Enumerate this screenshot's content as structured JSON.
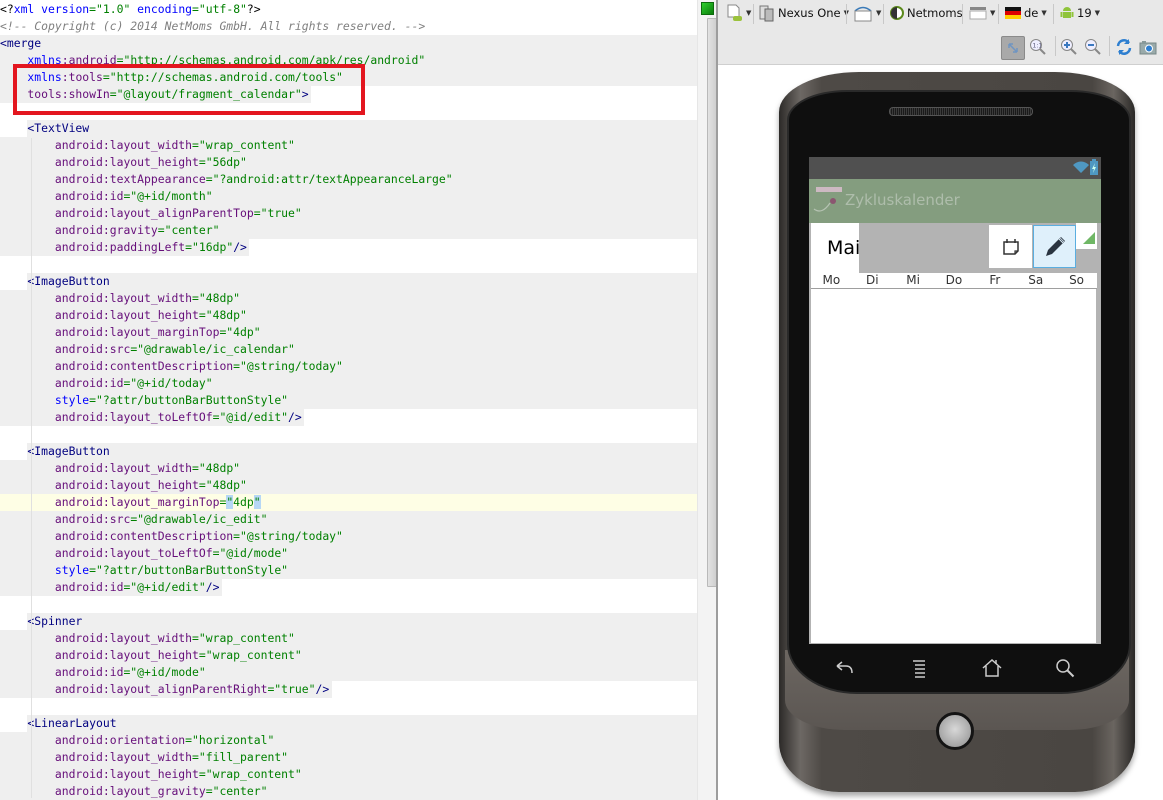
{
  "editor": {
    "lines": [
      {
        "bg": "none",
        "tokens": [
          [
            "t-punct",
            "<?"
          ],
          [
            "t-ns",
            "xml version"
          ],
          [
            "t-val",
            "=\"1.0\""
          ],
          [
            "t-ns",
            " encoding"
          ],
          [
            "t-val",
            "=\"utf-8\""
          ],
          [
            "t-punct",
            "?>"
          ]
        ]
      },
      {
        "bg": "none",
        "tokens": [
          [
            "t-cmt",
            "<!-- Copyright (c) 2014 NetMoms GmbH. All rights reserved. -->"
          ]
        ]
      },
      {
        "bg": "full",
        "tokens": [
          [
            "t-tag",
            "<merge"
          ]
        ]
      },
      {
        "bg": "full",
        "tokens": [
          [
            "t-ns",
            "    xmlns"
          ],
          [
            "t-attr",
            ":android"
          ],
          [
            "t-val",
            "=\"http://schemas.android.com/apk/res/android\""
          ]
        ]
      },
      {
        "bg": "full",
        "tokens": [
          [
            "t-ns",
            "    xmlns"
          ],
          [
            "t-attr",
            ":tools"
          ],
          [
            "t-val",
            "=\"http://schemas.android.com/tools\""
          ]
        ]
      },
      {
        "bg": "text",
        "tokens": [
          [
            "t-attr",
            "    tools:showIn"
          ],
          [
            "t-val",
            "=\"@layout/fragment_calendar\""
          ],
          [
            "t-tag",
            ">"
          ]
        ]
      },
      {
        "bg": "none",
        "tokens": []
      },
      {
        "bg": "head",
        "tokens": [
          [
            "t-tag",
            "    <TextView"
          ]
        ]
      },
      {
        "bg": "full",
        "tokens": [
          [
            "t-attr",
            "        android:layout_width"
          ],
          [
            "t-val",
            "=\"wrap_content\""
          ]
        ]
      },
      {
        "bg": "full",
        "tokens": [
          [
            "t-attr",
            "        android:layout_height"
          ],
          [
            "t-val",
            "=\"56dp\""
          ]
        ]
      },
      {
        "bg": "full",
        "tokens": [
          [
            "t-attr",
            "        android:textAppearance"
          ],
          [
            "t-val",
            "=\"?android:attr/textAppearanceLarge\""
          ]
        ]
      },
      {
        "bg": "full",
        "tokens": [
          [
            "t-attr",
            "        android:id"
          ],
          [
            "t-val",
            "=\"@+id/month\""
          ]
        ]
      },
      {
        "bg": "full",
        "tokens": [
          [
            "t-attr",
            "        android:layout_alignParentTop"
          ],
          [
            "t-val",
            "=\"true\""
          ]
        ]
      },
      {
        "bg": "full",
        "tokens": [
          [
            "t-attr",
            "        android:gravity"
          ],
          [
            "t-val",
            "=\"center\""
          ]
        ]
      },
      {
        "bg": "text",
        "tokens": [
          [
            "t-attr",
            "        android:paddingLeft"
          ],
          [
            "t-val",
            "=\"16dp\""
          ],
          [
            "t-tag",
            "/>"
          ]
        ]
      },
      {
        "bg": "none",
        "tokens": []
      },
      {
        "bg": "head",
        "tokens": [
          [
            "t-tag",
            "    <ImageButton"
          ]
        ]
      },
      {
        "bg": "full",
        "tokens": [
          [
            "t-attr",
            "        android:layout_width"
          ],
          [
            "t-val",
            "=\"48dp\""
          ]
        ]
      },
      {
        "bg": "full",
        "tokens": [
          [
            "t-attr",
            "        android:layout_height"
          ],
          [
            "t-val",
            "=\"48dp\""
          ]
        ]
      },
      {
        "bg": "full",
        "tokens": [
          [
            "t-attr",
            "        android:layout_marginTop"
          ],
          [
            "t-val",
            "=\"4dp\""
          ]
        ]
      },
      {
        "bg": "full",
        "tokens": [
          [
            "t-attr",
            "        android:src"
          ],
          [
            "t-val",
            "=\"@drawable/ic_calendar\""
          ]
        ]
      },
      {
        "bg": "full",
        "tokens": [
          [
            "t-attr",
            "        android:contentDescription"
          ],
          [
            "t-val",
            "=\"@string/today\""
          ]
        ]
      },
      {
        "bg": "full",
        "tokens": [
          [
            "t-attr",
            "        android:id"
          ],
          [
            "t-val",
            "=\"@+id/today\""
          ]
        ]
      },
      {
        "bg": "full",
        "tokens": [
          [
            "t-ns",
            "        style"
          ],
          [
            "t-val",
            "=\"?attr/buttonBarButtonStyle\""
          ]
        ]
      },
      {
        "bg": "text",
        "tokens": [
          [
            "t-attr",
            "        android:layout_toLeftOf"
          ],
          [
            "t-val",
            "=\"@id/edit\""
          ],
          [
            "t-tag",
            "/>"
          ]
        ]
      },
      {
        "bg": "none",
        "tokens": []
      },
      {
        "bg": "head",
        "tokens": [
          [
            "t-tag",
            "    <ImageButton"
          ]
        ]
      },
      {
        "bg": "full",
        "tokens": [
          [
            "t-attr",
            "        android:layout_width"
          ],
          [
            "t-val",
            "=\"48dp\""
          ]
        ]
      },
      {
        "bg": "full",
        "tokens": [
          [
            "t-attr",
            "        android:layout_height"
          ],
          [
            "t-val",
            "=\"48dp\""
          ]
        ]
      },
      {
        "bg": "caret",
        "tokens": [
          [
            "t-attr",
            "        android:layout_marginTop"
          ],
          [
            "t-val",
            "="
          ],
          [
            "t-val sel",
            "\""
          ],
          [
            "t-val",
            "4dp"
          ],
          [
            "t-val sel",
            "\""
          ]
        ]
      },
      {
        "bg": "full",
        "tokens": [
          [
            "t-attr",
            "        android:src"
          ],
          [
            "t-val",
            "=\"@drawable/ic_edit\""
          ]
        ]
      },
      {
        "bg": "full",
        "tokens": [
          [
            "t-attr",
            "        android:contentDescription"
          ],
          [
            "t-val",
            "=\"@string/today\""
          ]
        ]
      },
      {
        "bg": "full",
        "tokens": [
          [
            "t-attr",
            "        android:layout_toLeftOf"
          ],
          [
            "t-val",
            "=\"@id/mode\""
          ]
        ]
      },
      {
        "bg": "full",
        "tokens": [
          [
            "t-ns",
            "        style"
          ],
          [
            "t-val",
            "=\"?attr/buttonBarButtonStyle\""
          ]
        ]
      },
      {
        "bg": "text",
        "tokens": [
          [
            "t-attr",
            "        android:id"
          ],
          [
            "t-val",
            "=\"@+id/edit\""
          ],
          [
            "t-tag",
            "/>"
          ]
        ]
      },
      {
        "bg": "none",
        "tokens": []
      },
      {
        "bg": "head",
        "tokens": [
          [
            "t-tag",
            "    <Spinner"
          ]
        ]
      },
      {
        "bg": "full",
        "tokens": [
          [
            "t-attr",
            "        android:layout_width"
          ],
          [
            "t-val",
            "=\"wrap_content\""
          ]
        ]
      },
      {
        "bg": "full",
        "tokens": [
          [
            "t-attr",
            "        android:layout_height"
          ],
          [
            "t-val",
            "=\"wrap_content\""
          ]
        ]
      },
      {
        "bg": "full",
        "tokens": [
          [
            "t-attr",
            "        android:id"
          ],
          [
            "t-val",
            "=\"@+id/mode\""
          ]
        ]
      },
      {
        "bg": "text",
        "tokens": [
          [
            "t-attr",
            "        android:layout_alignParentRight"
          ],
          [
            "t-val",
            "=\"true\""
          ],
          [
            "t-tag",
            "/>"
          ]
        ]
      },
      {
        "bg": "none",
        "tokens": []
      },
      {
        "bg": "head",
        "tokens": [
          [
            "t-tag",
            "    <LinearLayout"
          ]
        ]
      },
      {
        "bg": "full",
        "tokens": [
          [
            "t-attr",
            "        android:orientation"
          ],
          [
            "t-val",
            "=\"horizontal\""
          ]
        ]
      },
      {
        "bg": "full",
        "tokens": [
          [
            "t-attr",
            "        android:layout_width"
          ],
          [
            "t-val",
            "=\"fill_parent\""
          ]
        ]
      },
      {
        "bg": "full",
        "tokens": [
          [
            "t-attr",
            "        android:layout_height"
          ],
          [
            "t-val",
            "=\"wrap_content\""
          ]
        ]
      },
      {
        "bg": "full",
        "tokens": [
          [
            "t-attr",
            "        android:layout_gravity"
          ],
          [
            "t-val",
            "=\"center\""
          ]
        ]
      }
    ]
  },
  "toolbar": {
    "config_icon": "android-config-icon",
    "device_label": "Nexus One",
    "orientation_icon": "rotate-icon",
    "theme_label": "Netmoms",
    "activity_icon": "layout-icon",
    "locale_label": "de",
    "api_label": "19",
    "zoom_tools": [
      "zoom-fit-icon",
      "zoom-actual-icon",
      "zoom-in-icon",
      "zoom-out-icon",
      "refresh-icon",
      "screenshot-icon"
    ]
  },
  "phone": {
    "app_title": "Zykluskalender",
    "month_label": "Mai",
    "weekdays": [
      "Mo",
      "Di",
      "Mi",
      "Do",
      "Fr",
      "Sa",
      "So"
    ],
    "nav_buttons": [
      "back",
      "menu",
      "home",
      "search"
    ]
  },
  "colors": {
    "highlight_box": "#e3161f",
    "action_bar": "#849d7f",
    "edit_button_bg": "#dff0fb"
  }
}
